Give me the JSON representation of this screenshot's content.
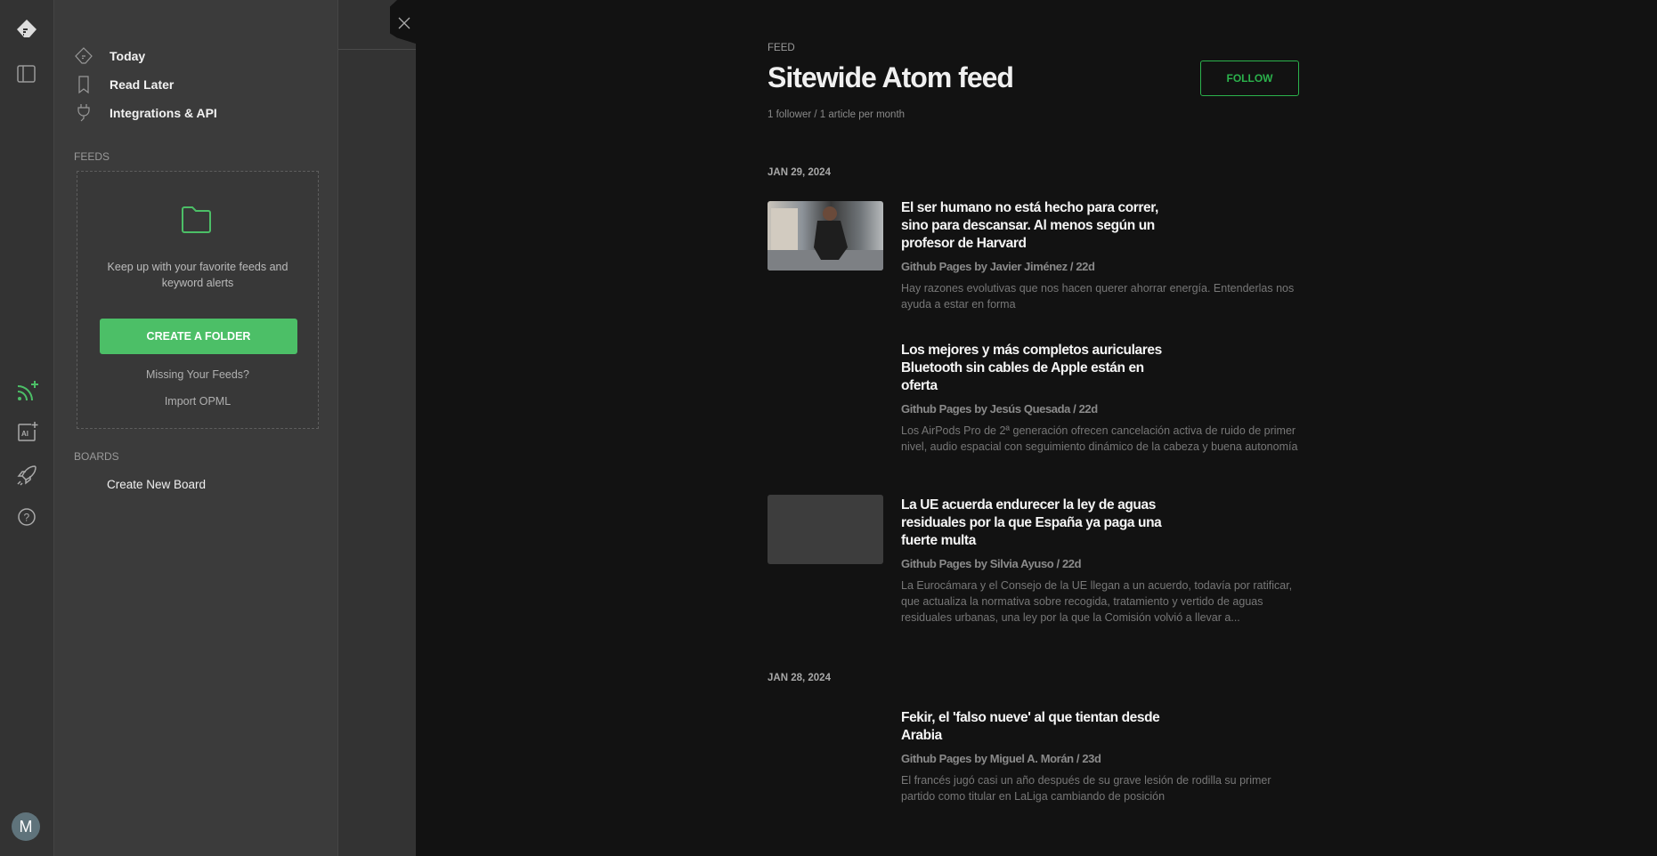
{
  "rail": {
    "icons": [
      "feedly-logo-icon",
      "panel-toggle-icon",
      "add-feed-icon",
      "ai-feed-icon",
      "rocket-icon",
      "help-icon"
    ],
    "avatar": "M",
    "accent": "#4cbf67"
  },
  "sidebar": {
    "nav": [
      {
        "label": "Today",
        "icon": "today-icon"
      },
      {
        "label": "Read Later",
        "icon": "bookmark-icon"
      },
      {
        "label": "Integrations & API",
        "icon": "plug-icon"
      }
    ],
    "feeds_label": "FEEDS",
    "empty_text": "Keep up with your favorite feeds and keyword alerts",
    "create_folder": "CREATE A FOLDER",
    "missing": "Missing Your Feeds?",
    "import": "Import OPML",
    "boards_label": "BOARDS",
    "create_board": "Create New Board"
  },
  "feed": {
    "kicker": "FEED",
    "title": "Sitewide Atom feed",
    "stats": "1 follower / 1 article per month",
    "follow": "FOLLOW",
    "groups": [
      {
        "date": "JAN 29, 2024",
        "articles": [
          {
            "title": "El ser humano no está hecho para correr, sino para descansar. Al menos según un profesor de Harvard",
            "meta": "Github Pages by Javier Jiménez / 22d",
            "desc": "Hay razones evolutivas que nos hacen querer ahorrar energía. Entenderlas nos ayuda a estar en forma"
          },
          {
            "title": "Los mejores y más completos auriculares Bluetooth sin cables de Apple están en oferta",
            "meta": "Github Pages by Jesús Quesada / 22d",
            "desc": "Los AirPods Pro de 2ª generación ofrecen cancelación activa de ruido de primer nivel, audio espacial con seguimiento dinámico de la cabeza y buena autonomía"
          },
          {
            "title": "La UE acuerda endurecer la ley de aguas residuales por la que España ya paga una fuerte multa",
            "meta": "Github Pages by Silvia Ayuso / 22d",
            "desc": "La Eurocámara y el Consejo de la UE llegan a un acuerdo, todavía por ratificar, que actualiza la normativa sobre recogida, tratamiento y vertido de aguas residuales urbanas, una ley por la que la Comisión volvió a llevar a..."
          }
        ]
      },
      {
        "date": "JAN 28, 2024",
        "articles": [
          {
            "title": "Fekir, el 'falso nueve' al que tientan desde Arabia",
            "meta": "Github Pages by Miguel A. Morán / 23d",
            "desc": "El francés jugó casi un año después de su grave lesión de rodilla su primer partido como titular en LaLiga cambiando de posición"
          }
        ]
      }
    ]
  }
}
